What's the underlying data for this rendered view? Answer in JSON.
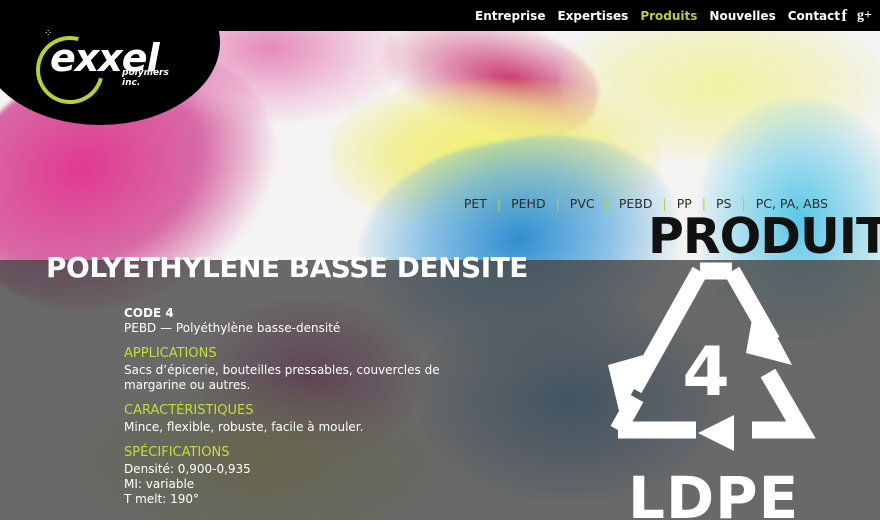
{
  "nav": {
    "items": [
      "Entreprise",
      "Expertises",
      "Produits",
      "Nouvelles",
      "Contact"
    ],
    "active": "Produits",
    "social": {
      "facebook": "f",
      "google": "g+"
    }
  },
  "logo": {
    "name": "exxel",
    "sub": "polymers inc."
  },
  "subnav": [
    "PET",
    "PEHD",
    "PVC",
    "PEBD",
    "PP",
    "PS",
    "PC, PA, ABS"
  ],
  "hero": {
    "banner": "PRODUIT"
  },
  "page": {
    "title": "POLYETHYLENE BASSE DENSITE",
    "code": "CODE 4",
    "code_desc": "PEBD — Polyéthylène basse-densité",
    "applications_heading": "APPLICATIONS",
    "applications_text": "Sacs d’épicerie, bouteilles pressables, couvercles de margarine ou autres.",
    "characteristics_heading": "CARACTÉRISTIQUES",
    "characteristics_text": "Mince, flexible, robuste, facile à mouler.",
    "specifications_heading": "SPÉCIFICATIONS",
    "specs": [
      "Densité: 0,900-0,935",
      "MI: variable",
      "T melt: 190°"
    ]
  },
  "symbol": {
    "number": "4",
    "label": "LDPE"
  },
  "colors": {
    "accent": "#b4d137",
    "heading": "#c5dd39",
    "topbar": "#000000"
  }
}
